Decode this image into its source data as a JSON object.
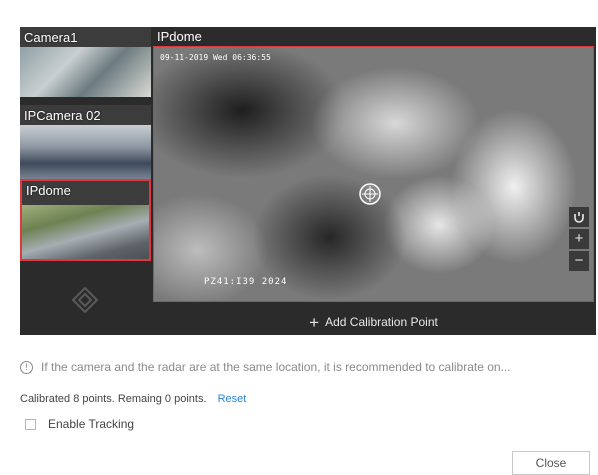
{
  "cameras": [
    {
      "label": "Camera1"
    },
    {
      "label": "IPCamera 02"
    },
    {
      "label": "IPdome"
    }
  ],
  "video": {
    "title": "IPdome",
    "osd_time": "09-11-2019 Wed 06:36:55",
    "osd_ptz": "PZ41:I39  2024",
    "zoom_in": "+",
    "zoom_out": "−"
  },
  "add_calibration_label": "Add Calibration Point",
  "info_text": "If the camera and the radar are at the same location, it is recommended to calibrate on...",
  "calibration": {
    "status": "Calibrated 8 points. Remaing 0 points.",
    "reset_label": "Reset"
  },
  "tracking": {
    "label": "Enable Tracking",
    "checked": false
  },
  "close_label": "Close",
  "colors": {
    "selected_border": "#e0383e",
    "link": "#2b84d6",
    "panel_bg": "#2b2b2b"
  },
  "icons": [
    "direction-control-icon",
    "crosshair-icon",
    "lens-icon",
    "info-icon"
  ]
}
